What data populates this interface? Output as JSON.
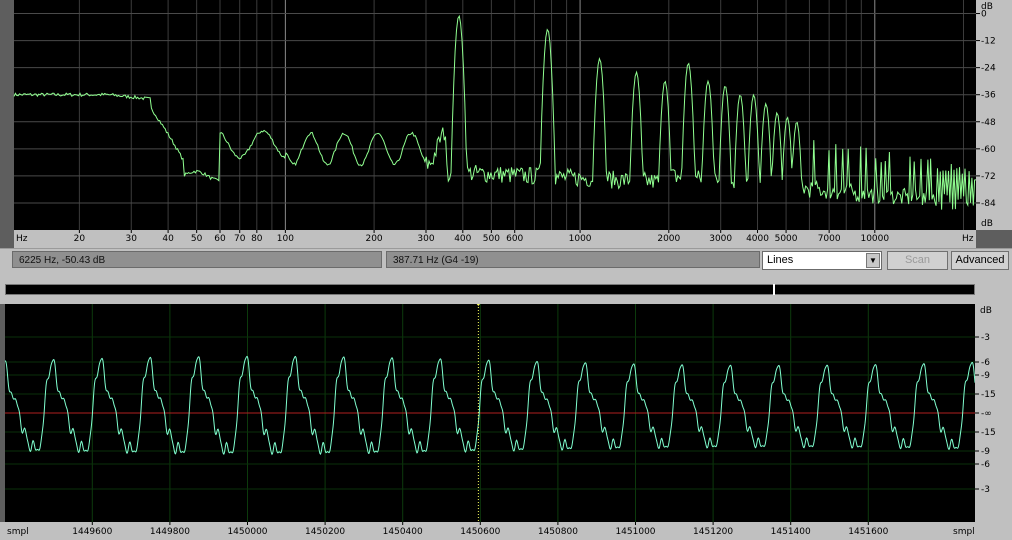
{
  "spectrum": {
    "freq_axis_unit_left": "Hz",
    "freq_axis_unit_right": "Hz",
    "freq_ticks": [
      {
        "hz": 20,
        "label": "20"
      },
      {
        "hz": 30,
        "label": "30"
      },
      {
        "hz": 40,
        "label": "40"
      },
      {
        "hz": 50,
        "label": "50"
      },
      {
        "hz": 60,
        "label": "60"
      },
      {
        "hz": 70,
        "label": "70"
      },
      {
        "hz": 80,
        "label": "80"
      },
      {
        "hz": 100,
        "label": "100"
      },
      {
        "hz": 200,
        "label": "200"
      },
      {
        "hz": 300,
        "label": "300"
      },
      {
        "hz": 400,
        "label": "400"
      },
      {
        "hz": 500,
        "label": "500"
      },
      {
        "hz": 600,
        "label": "600"
      },
      {
        "hz": 1000,
        "label": "1000"
      },
      {
        "hz": 2000,
        "label": "2000"
      },
      {
        "hz": 3000,
        "label": "3000"
      },
      {
        "hz": 4000,
        "label": "4000"
      },
      {
        "hz": 5000,
        "label": "5000"
      },
      {
        "hz": 7000,
        "label": "7000"
      },
      {
        "hz": 10000,
        "label": "10000"
      }
    ],
    "freq_range": [
      12,
      22050
    ],
    "db_unit_top": "dB",
    "db_unit_bottom": "dB",
    "db_ticks": [
      "0",
      "-12",
      "-24",
      "-36",
      "-48",
      "-60",
      "-72",
      "-84"
    ],
    "db_range": [
      -96,
      6
    ],
    "line_color": "#90ff90",
    "peaks": [
      {
        "hz": 388,
        "db": -1
      },
      {
        "hz": 776,
        "db": -7
      },
      {
        "hz": 1165,
        "db": -20
      },
      {
        "hz": 1553,
        "db": -26
      },
      {
        "hz": 1941,
        "db": -30
      },
      {
        "hz": 2330,
        "db": -22
      },
      {
        "hz": 2718,
        "db": -30
      },
      {
        "hz": 3106,
        "db": -32
      },
      {
        "hz": 3494,
        "db": -36
      },
      {
        "hz": 3882,
        "db": -36
      },
      {
        "hz": 4270,
        "db": -40
      },
      {
        "hz": 4660,
        "db": -44
      },
      {
        "hz": 5050,
        "db": -46
      },
      {
        "hz": 5435,
        "db": -48
      }
    ]
  },
  "status": {
    "cursor_readout": "6225 Hz, -50.43 dB",
    "peak_readout": "387.71 Hz (G4 -19)",
    "view_mode": "Lines",
    "scan_label": "Scan",
    "advanced_label": "Advanced"
  },
  "waveform": {
    "axis_unit_left": "smpl",
    "axis_unit_right": "smpl",
    "sample_ticks": [
      "1449600",
      "1449800",
      "1450000",
      "1450200",
      "1450400",
      "1450600",
      "1450800",
      "1451000",
      "1451200",
      "1451400",
      "1451600"
    ],
    "sample_range": [
      1449375,
      1451875
    ],
    "cursor_sample": 1450595,
    "db_unit": "dB",
    "db_ticks": [
      "-3",
      "-6",
      "-9",
      "-15",
      "-∞",
      "-15",
      "-9",
      "-6",
      "-3"
    ],
    "wave_color": "#80ffd0",
    "zero_line_color": "#b02020",
    "cursor_color": "#ffff60",
    "period_samples": 124.6
  },
  "colors": {
    "plot_bg": "#000000",
    "grid_major": "#5a5a5a",
    "grid_wave": "#0a3a0a",
    "panel_bg": "#c0c0c0"
  }
}
